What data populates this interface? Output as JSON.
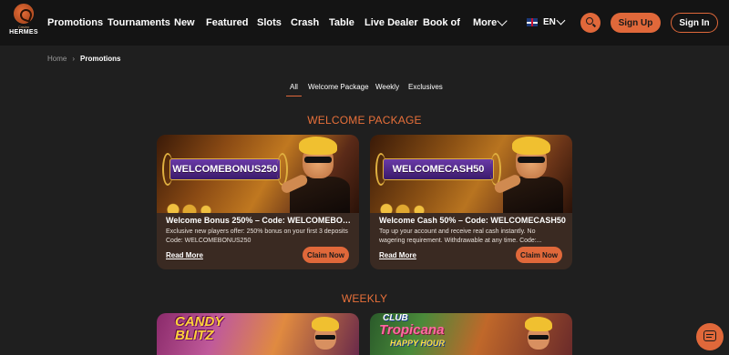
{
  "brand": {
    "small": "Casino",
    "name": "HERMES"
  },
  "nav": {
    "items": [
      "Promotions",
      "Tournaments",
      "New",
      "Featured",
      "Slots",
      "Crash",
      "Table",
      "Live Dealer",
      "Book of"
    ],
    "more": "More",
    "language": "EN",
    "sign_up": "Sign Up",
    "sign_in": "Sign In"
  },
  "breadcrumb": {
    "home": "Home",
    "current": "Promotions"
  },
  "tabs": [
    "All",
    "Welcome Package",
    "Weekly",
    "Exclusives"
  ],
  "active_tab": "All",
  "sections": {
    "welcome": {
      "title": "WELCOME PACKAGE",
      "cards": [
        {
          "banner": "WELCOMEBONUS250",
          "title": "Welcome Bonus 250% – Code: WELCOMEBONU...",
          "description": "Exclusive new players offer: 250% bonus on your first 3 deposits Code: WELCOMEBONUS250",
          "read_more": "Read More",
          "claim": "Claim Now"
        },
        {
          "banner": "WELCOMECASH50",
          "title": "Welcome Cash 50% – Code: WELCOMECASH50",
          "description": "Top up your account and receive real cash instantly. No wagering requirement. Withdrawable at any time. Code:...",
          "read_more": "Read More",
          "claim": "Claim Now"
        }
      ]
    },
    "weekly": {
      "title": "WEEKLY",
      "cards": [
        {
          "logo": "CANDY BLITZ",
          "logo_line1": "CANDY",
          "logo_line2": "BLITZ"
        },
        {
          "logo_line1": "CLUB",
          "logo_line2": "Tropicana",
          "logo_line3": "HAPPY HOUR"
        }
      ]
    }
  },
  "colors": {
    "accent": "#e0683a",
    "background": "#1f1f1f",
    "header": "#141414",
    "card": "#3a2a22",
    "section_title": "#e8703a"
  }
}
